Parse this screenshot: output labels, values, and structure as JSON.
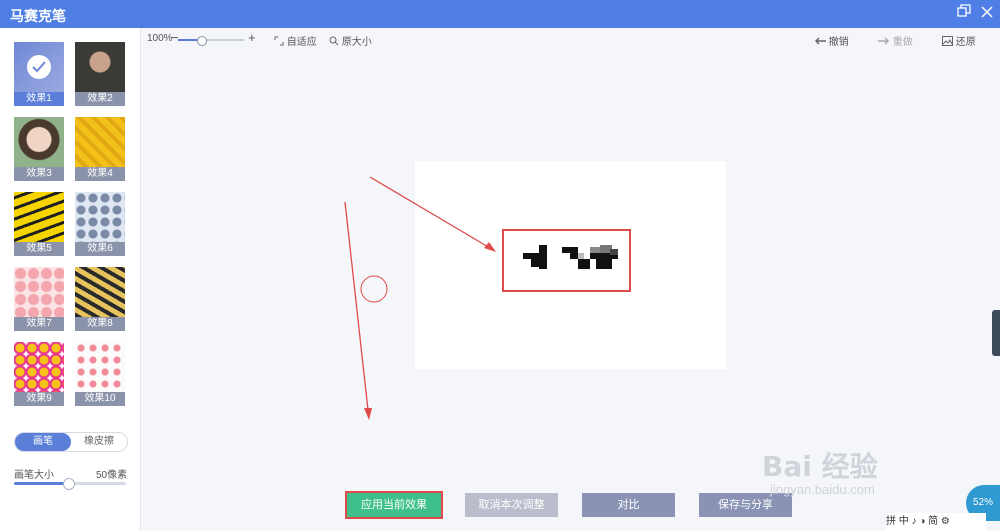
{
  "window": {
    "title": "马赛克笔",
    "restore_icon": "restore-icon",
    "close_icon": "close-icon",
    "accent": "#4f7ee4"
  },
  "sidebar": {
    "effects": [
      {
        "label": "效果1",
        "selected": true
      },
      {
        "label": "效果2"
      },
      {
        "label": "效果3"
      },
      {
        "label": "效果4"
      },
      {
        "label": "效果5"
      },
      {
        "label": "效果6"
      },
      {
        "label": "效果7"
      },
      {
        "label": "效果8"
      },
      {
        "label": "效果9"
      },
      {
        "label": "效果10"
      }
    ],
    "mode_toggle": {
      "brush": "画笔",
      "eraser": "橡皮擦",
      "active": "画笔"
    },
    "brush_size": {
      "label": "画笔大小",
      "value": "50像素",
      "level": 0.48
    }
  },
  "toolbar": {
    "zoom": "100%",
    "zoom_level": 0.35,
    "zoom_out": "−",
    "zoom_in": "+",
    "fit": "自适应",
    "original_size": "原大小",
    "undo": "撤销",
    "redo": "重做",
    "restore": "还原"
  },
  "actions": {
    "apply": "应用当前效果",
    "cancel": "取消本次调整",
    "compare": "对比",
    "save_share": "保存与分享"
  },
  "overlay": {
    "watermark": "Bai 经验",
    "watermark_url": "jingyan.baidu.com",
    "ime": "拼 中 ♪ ◑ 简 ⚙",
    "widget": "52%"
  },
  "colors": {
    "apply_button": "#3fc08a",
    "secondary_button": "#8b93b5",
    "disabled_button": "#b9bdcc",
    "annotation_red": "#e04a4a"
  }
}
